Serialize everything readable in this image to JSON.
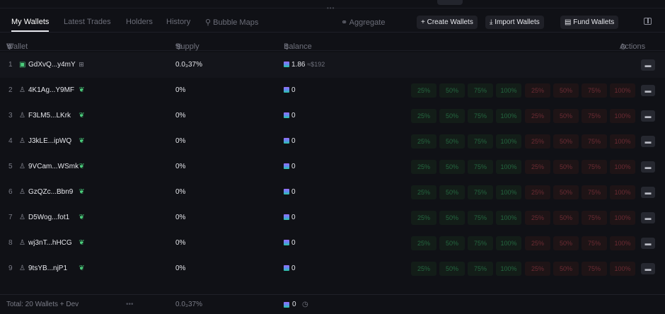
{
  "tabs": [
    {
      "label": "My Wallets",
      "active": true
    },
    {
      "label": "Latest Trades",
      "active": false
    },
    {
      "label": "Holders",
      "active": false
    },
    {
      "label": "History",
      "active": false
    },
    {
      "label": "Bubble Maps",
      "active": false
    }
  ],
  "toolbar": {
    "aggregate_label": "Aggregate",
    "create_label": "+ Create Wallets",
    "import_label": "Import Wallets",
    "fund_label": "Fund Wallets"
  },
  "columns": {
    "wallet": "Wallet",
    "supply": "Supply",
    "balance": "Balance",
    "actions": "Actions"
  },
  "quick_amounts": {
    "buy": [
      "25%",
      "50%",
      "75%",
      "100%"
    ],
    "sell": [
      "25%",
      "50%",
      "75%",
      "100%"
    ]
  },
  "wallets": [
    {
      "index": "1",
      "name": "GdXvQ...y4mY",
      "supply": "0.0₃37%",
      "balance": "1.86",
      "usd": "≈$192"
    },
    {
      "index": "2",
      "name": "4K1Ag...Y9MF",
      "supply": "0%",
      "balance": "0",
      "usd": ""
    },
    {
      "index": "3",
      "name": "F3LM5...LKrk",
      "supply": "0%",
      "balance": "0",
      "usd": ""
    },
    {
      "index": "4",
      "name": "J3kLE...ipWQ",
      "supply": "0%",
      "balance": "0",
      "usd": ""
    },
    {
      "index": "5",
      "name": "9VCam...WSmk",
      "supply": "0%",
      "balance": "0",
      "usd": ""
    },
    {
      "index": "6",
      "name": "GzQZc...Bbn9",
      "supply": "0%",
      "balance": "0",
      "usd": ""
    },
    {
      "index": "7",
      "name": "D5Wog...fot1",
      "supply": "0%",
      "balance": "0",
      "usd": ""
    },
    {
      "index": "8",
      "name": "wj3nT...hHCG",
      "supply": "0%",
      "balance": "0",
      "usd": ""
    },
    {
      "index": "9",
      "name": "9tsYB...njP1",
      "supply": "0%",
      "balance": "0",
      "usd": ""
    }
  ],
  "footer": {
    "total": "Total: 20 Wallets + Dev",
    "supply": "0.0₃37%",
    "balance": "0"
  },
  "colors": {
    "accent_green": "#4cd07d",
    "buy_text": "#24663f",
    "sell_text": "#6b2b33",
    "background": "#101116"
  }
}
